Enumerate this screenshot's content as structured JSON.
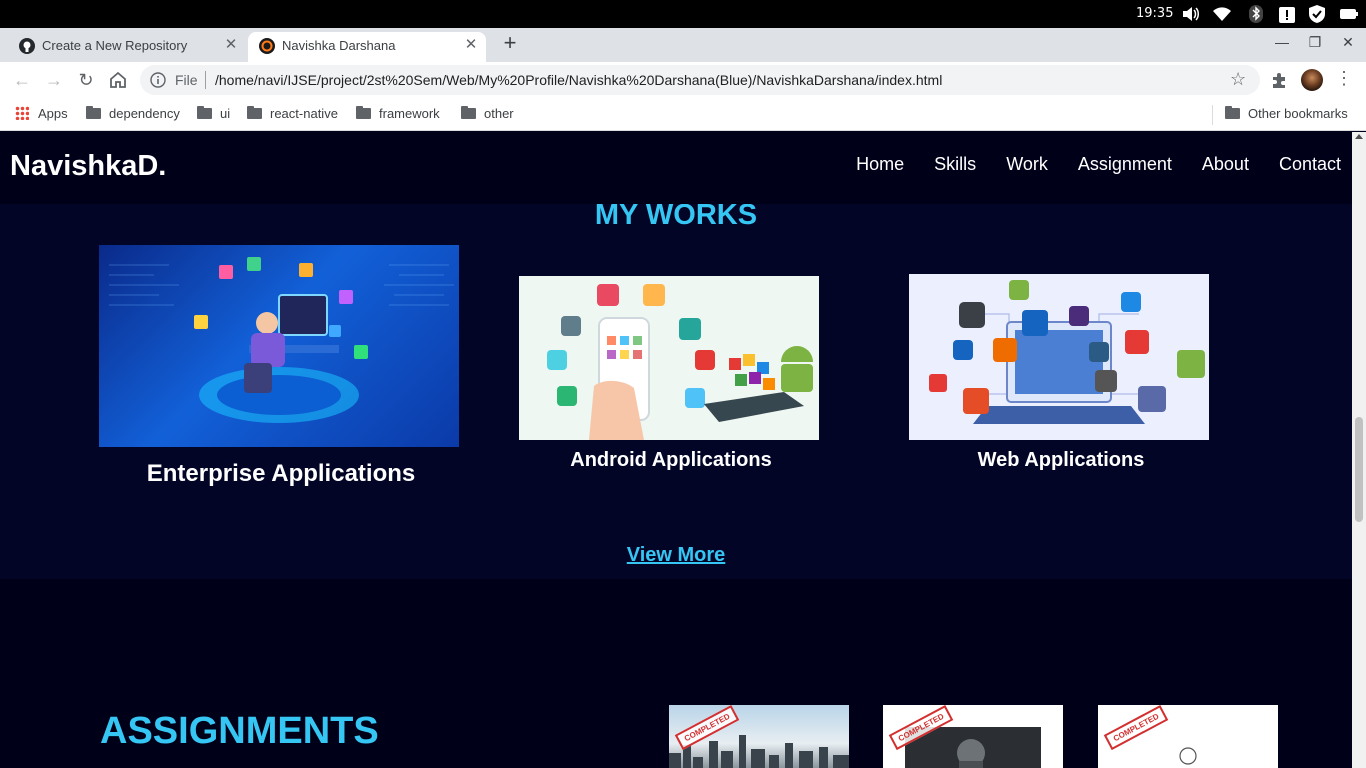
{
  "os": {
    "time": "19:35"
  },
  "tabs": [
    {
      "title": "Create a New Repository",
      "active": false,
      "favicon": "github-icon"
    },
    {
      "title": "Navishka Darshana",
      "active": true,
      "favicon": "site-favicon"
    }
  ],
  "toolbar": {
    "scheme_label": "File",
    "url": "/home/navi/IJSE/project/2st%20Sem/Web/My%20Profile/Navishka%20Darshana(Blue)/NavishkaDarshana/index.html"
  },
  "bookmarks": {
    "apps_label": "Apps",
    "folders": [
      "dependency",
      "ui",
      "react-native",
      "framework",
      "other"
    ],
    "other_label": "Other bookmarks"
  },
  "site": {
    "brand": "NavishkaD.",
    "nav": [
      "Home",
      "Skills",
      "Work",
      "Assignment",
      "About",
      "Contact"
    ],
    "works_title": "MY WORKS",
    "works": [
      {
        "label": "Enterprise Applications"
      },
      {
        "label": "Android Applications"
      },
      {
        "label": "Web Applications"
      }
    ],
    "view_more": "View More",
    "assignments_title": "ASSIGNMENTS",
    "stamp_label": "COMPLETED"
  },
  "colors": {
    "page_bg": "#000119",
    "section_bg": "#030526",
    "accent": "#35c6f4"
  }
}
